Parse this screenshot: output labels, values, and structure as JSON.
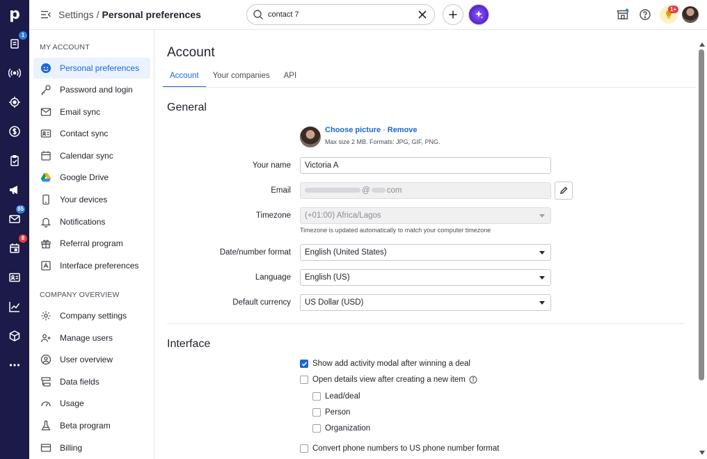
{
  "app": {
    "logo_letter": "p",
    "rail_badges": {
      "leads": "1",
      "mail": "85",
      "calendar": "8"
    }
  },
  "header": {
    "breadcrumb_root": "Settings",
    "breadcrumb_sep": "/",
    "breadcrumb_current": "Personal preferences",
    "search_value": "contact 7",
    "notification_badge": "1+"
  },
  "sidebar": {
    "my_account_title": "MY ACCOUNT",
    "my_account_items": [
      {
        "label": "Personal preferences",
        "icon": "smiley-icon",
        "active": true
      },
      {
        "label": "Password and login",
        "icon": "key-icon"
      },
      {
        "label": "Email sync",
        "icon": "envelope-icon"
      },
      {
        "label": "Contact sync",
        "icon": "contact-card-icon"
      },
      {
        "label": "Calendar sync",
        "icon": "calendar-icon"
      },
      {
        "label": "Google Drive",
        "icon": "google-drive-icon"
      },
      {
        "label": "Your devices",
        "icon": "phone-icon"
      },
      {
        "label": "Notifications",
        "icon": "bell-icon"
      },
      {
        "label": "Referral program",
        "icon": "gift-icon"
      },
      {
        "label": "Interface preferences",
        "icon": "interface-icon"
      }
    ],
    "company_title": "COMPANY OVERVIEW",
    "company_items": [
      {
        "label": "Company settings",
        "icon": "gear-icon"
      },
      {
        "label": "Manage users",
        "icon": "users-icon"
      },
      {
        "label": "User overview",
        "icon": "user-circle-icon"
      },
      {
        "label": "Data fields",
        "icon": "data-fields-icon"
      },
      {
        "label": "Usage",
        "icon": "gauge-icon"
      },
      {
        "label": "Beta program",
        "icon": "flask-icon"
      },
      {
        "label": "Billing",
        "icon": "credit-card-icon"
      }
    ]
  },
  "main": {
    "title": "Account",
    "tabs": [
      "Account",
      "Your companies",
      "API"
    ],
    "general_title": "General",
    "picture": {
      "choose": "Choose picture",
      "dot": "·",
      "remove": "Remove",
      "hint": "Max size 2 MB. Formats: JPG, GIF, PNG."
    },
    "fields": {
      "name_label": "Your name",
      "name_value": "Victoria A",
      "email_label": "Email",
      "email_visible": "@",
      "email_mid": "com",
      "timezone_label": "Timezone",
      "timezone_value": "(+01:00) Africa/Lagos",
      "timezone_hint": "Timezone is updated automatically to match your computer timezone",
      "date_label": "Date/number format",
      "date_value": "English (United States)",
      "language_label": "Language",
      "language_value": "English (US)",
      "currency_label": "Default currency",
      "currency_value": "US Dollar (USD)"
    },
    "interface_title": "Interface",
    "checkboxes": [
      {
        "label": "Show add activity modal after winning a deal",
        "checked": true
      },
      {
        "label": "Open details view after creating a new item",
        "checked": false
      },
      {
        "label": "Lead/deal",
        "checked": false
      },
      {
        "label": "Person",
        "checked": false
      },
      {
        "label": "Organization",
        "checked": false
      },
      {
        "label": "Convert phone numbers to US phone number format",
        "checked": false
      }
    ]
  },
  "colors": {
    "rail": "#1b1a48",
    "accent": "#1a66d6",
    "active_bg": "#eaf2fd"
  }
}
